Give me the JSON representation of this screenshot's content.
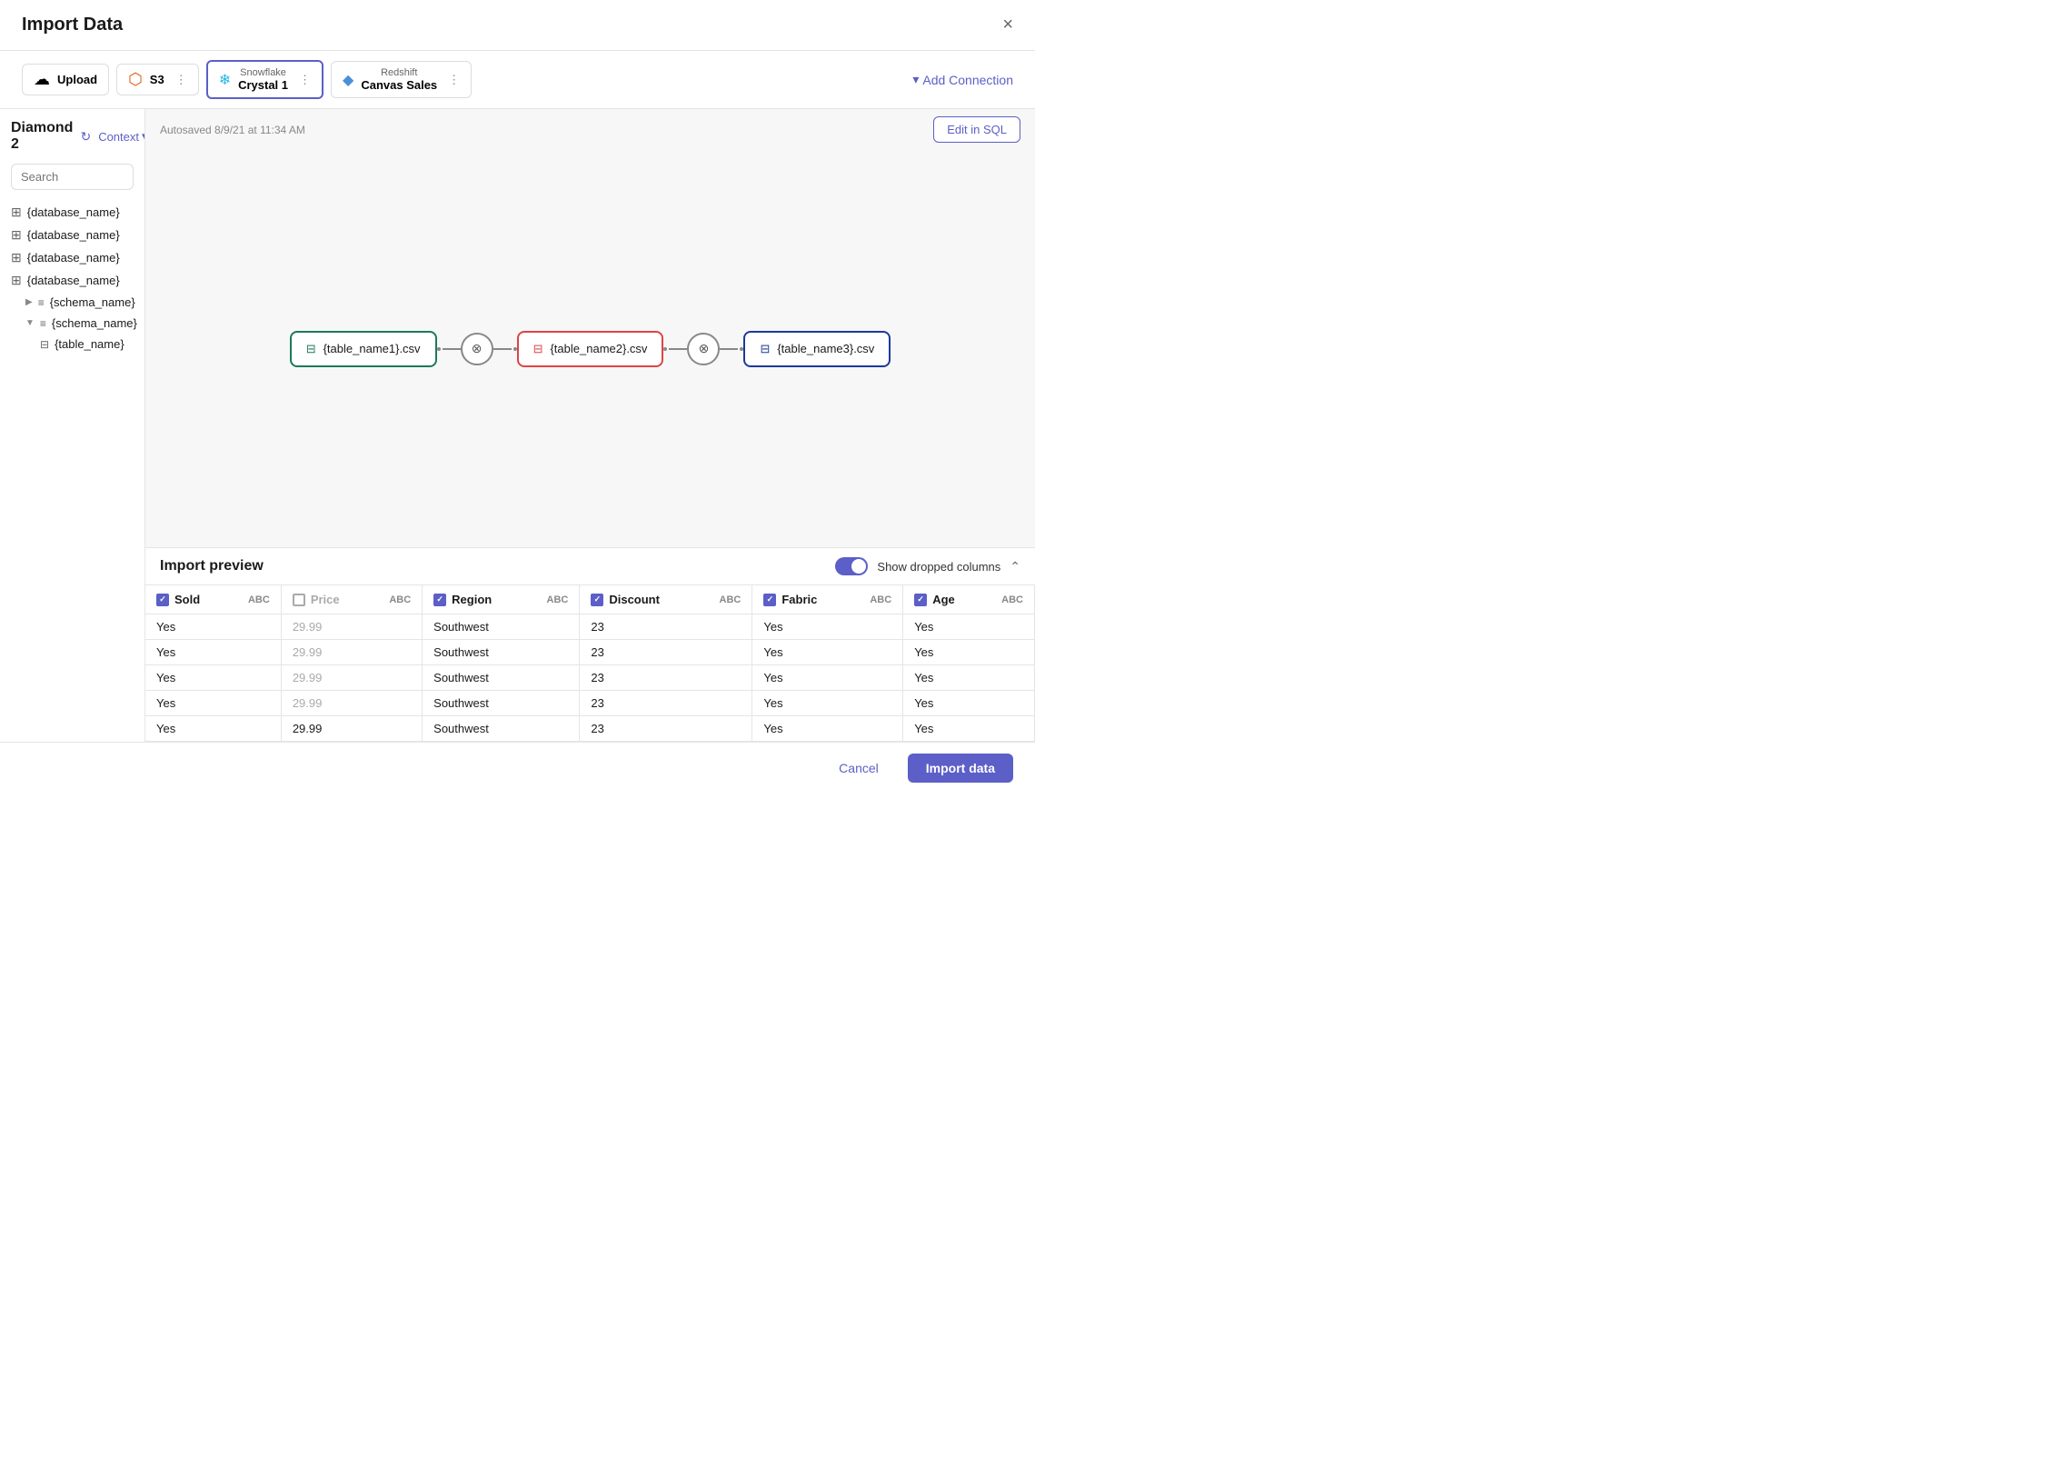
{
  "modal": {
    "title": "Import Data",
    "close_label": "×"
  },
  "connections": [
    {
      "id": "upload",
      "type": "",
      "name": "Upload",
      "icon": "upload-icon",
      "active": false
    },
    {
      "id": "s3",
      "type": "",
      "name": "S3",
      "icon": "s3-icon",
      "active": false
    },
    {
      "id": "snowflake",
      "type": "Snowflake",
      "name": "Crystal 1",
      "icon": "snowflake-icon",
      "active": true
    },
    {
      "id": "redshift",
      "type": "Redshift",
      "name": "Canvas Sales",
      "icon": "redshift-icon",
      "active": false
    }
  ],
  "add_connection": {
    "label": "Add Connection"
  },
  "sidebar": {
    "title": "Diamond 2",
    "context_label": "Context",
    "search_placeholder": "Search",
    "databases": [
      {
        "name": "{database_name}",
        "expanded": false
      },
      {
        "name": "{database_name}",
        "expanded": false
      },
      {
        "name": "{database_name}",
        "expanded": false
      },
      {
        "name": "{database_name}",
        "expanded": true,
        "schemas": [
          {
            "name": "{schema_name}",
            "expanded": false
          },
          {
            "name": "{schema_name}",
            "expanded": true,
            "tables": [
              {
                "name": "{table_name}"
              }
            ]
          }
        ]
      }
    ]
  },
  "canvas": {
    "autosave": "Autosaved 8/9/21 at 11:34 AM",
    "edit_sql_label": "Edit in SQL",
    "nodes": [
      {
        "id": "node1",
        "label": "{table_name1}.csv",
        "style": "green"
      },
      {
        "id": "node2",
        "label": "{table_name2}.csv",
        "style": "pink"
      },
      {
        "id": "node3",
        "label": "{table_name3}.csv",
        "style": "blue"
      }
    ]
  },
  "preview": {
    "title": "Import preview",
    "show_dropped_label": "Show dropped columns",
    "columns": [
      {
        "id": "sold",
        "label": "Sold",
        "type": "ABC",
        "checked": true
      },
      {
        "id": "price",
        "label": "Price",
        "type": "ABC",
        "checked": false
      },
      {
        "id": "region",
        "label": "Region",
        "type": "ABC",
        "checked": true
      },
      {
        "id": "discount",
        "label": "Discount",
        "type": "ABC",
        "checked": true
      },
      {
        "id": "fabric",
        "label": "Fabric",
        "type": "ABC",
        "checked": true
      },
      {
        "id": "age",
        "label": "Age",
        "type": "ABC",
        "checked": true
      }
    ],
    "rows": [
      {
        "sold": "Yes",
        "price": "29.99",
        "region": "Southwest",
        "discount": "23",
        "fabric": "Yes",
        "age": "Yes",
        "price_dim": true
      },
      {
        "sold": "Yes",
        "price": "29.99",
        "region": "Southwest",
        "discount": "23",
        "fabric": "Yes",
        "age": "Yes",
        "price_dim": true
      },
      {
        "sold": "Yes",
        "price": "29.99",
        "region": "Southwest",
        "discount": "23",
        "fabric": "Yes",
        "age": "Yes",
        "price_dim": true
      },
      {
        "sold": "Yes",
        "price": "29.99",
        "region": "Southwest",
        "discount": "23",
        "fabric": "Yes",
        "age": "Yes",
        "price_dim": true
      },
      {
        "sold": "Yes",
        "price": "29.99",
        "region": "Southwest",
        "discount": "23",
        "fabric": "Yes",
        "age": "Yes",
        "price_dim": false
      }
    ]
  },
  "footer": {
    "cancel_label": "Cancel",
    "import_label": "Import data"
  }
}
